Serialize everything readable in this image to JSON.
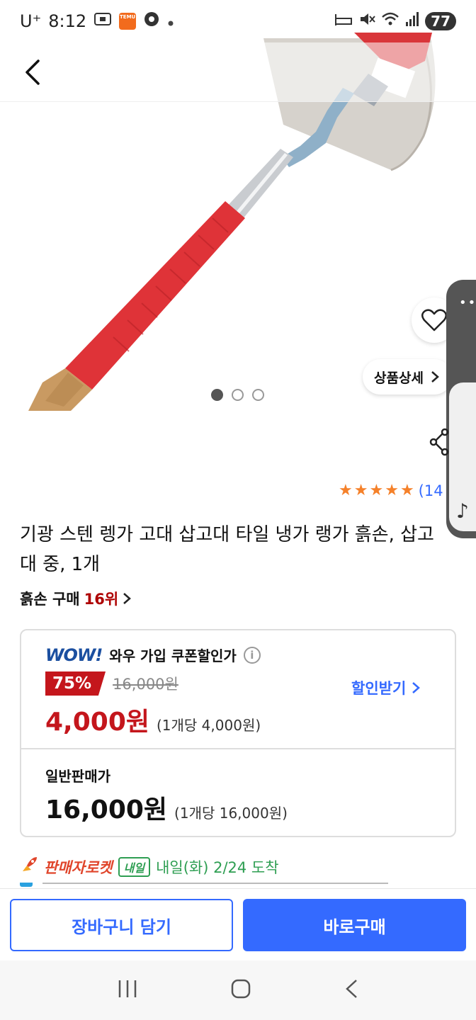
{
  "status_bar": {
    "carrier": "U⁺",
    "time": "8:12",
    "battery": "77",
    "temu_label": "TEMU"
  },
  "product": {
    "title": "기광 스텐 렝가 고대 삽고대 타일 냉가 랭가 흙손, 삽고대 중, 1개",
    "detail_button": "상품상세",
    "image_count": 3,
    "active_image": 1,
    "rating_count": "(14",
    "rating_stars": 5
  },
  "rank": {
    "category": "흙손 구매",
    "position": "16위"
  },
  "price": {
    "wow_logo": "WOW!",
    "wow_text": "와우 가입 쿠폰할인가",
    "discount": "75%",
    "original": "16,000원",
    "coupon_button": "할인받기",
    "sale_price": "4,000원",
    "sale_unit": "(1개당 4,000원)",
    "normal_label": "일반판매가",
    "normal_price": "16,000원",
    "normal_unit": "(1개당 16,000원)"
  },
  "delivery": {
    "rocket_label": "판매자로켓",
    "tomorrow_badge": "내일",
    "arrival": "내일(화) 2/24 도착"
  },
  "actions": {
    "cart": "장바구니 담기",
    "buy": "바로구매"
  },
  "colors": {
    "accent_blue": "#346aff",
    "sale_red": "#c4161c",
    "star_orange": "#f5812a",
    "delivery_green": "#2e9e52"
  }
}
